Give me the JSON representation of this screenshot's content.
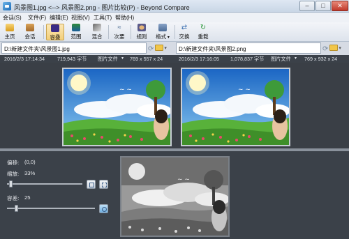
{
  "window": {
    "title": "风景图1.jpg <--> 风景图2.png - 图片比较(P) - Beyond Compare",
    "minimize": "–",
    "maximize": "□",
    "close": "✕"
  },
  "menu": [
    "会话(S)",
    "文件(F)",
    "编辑(E)",
    "视图(V)",
    "工具(T)",
    "帮助(H)"
  ],
  "toolbar": {
    "home": "主页",
    "sessions": "会话",
    "overlay": "容叠",
    "range": "范围",
    "blend": "混合",
    "next": "次要",
    "rules": "规则",
    "format": "格式",
    "swap": "交换",
    "reload": "重载"
  },
  "left": {
    "path": "D:\\新建文件夹\\风景图1.jpg",
    "date": "2016/2/3 17:14:34",
    "size": "719,943 字节",
    "type": "图片文件",
    "dims": "769 x 557 x 24"
  },
  "right": {
    "path": "D:\\新建文件夹\\风景图2.png",
    "date": "2016/2/3 17:16:05",
    "size": "1,078,837 字节",
    "type": "图片文件",
    "dims": "769 x 932 x 24"
  },
  "controls": {
    "offset_label": "偏移:",
    "offset_value": "(0,0)",
    "zoom_label": "缩放:",
    "zoom_value": "33%",
    "zoom_level": 0.05,
    "tolerance_label": "容差:",
    "tolerance_value": "25",
    "tolerance_level": 0.1
  },
  "colors": {
    "accent": "#f3cf7a",
    "dark_panel": "#3b4149",
    "sky": "#2a7fd8",
    "grass": "#57a83a"
  }
}
